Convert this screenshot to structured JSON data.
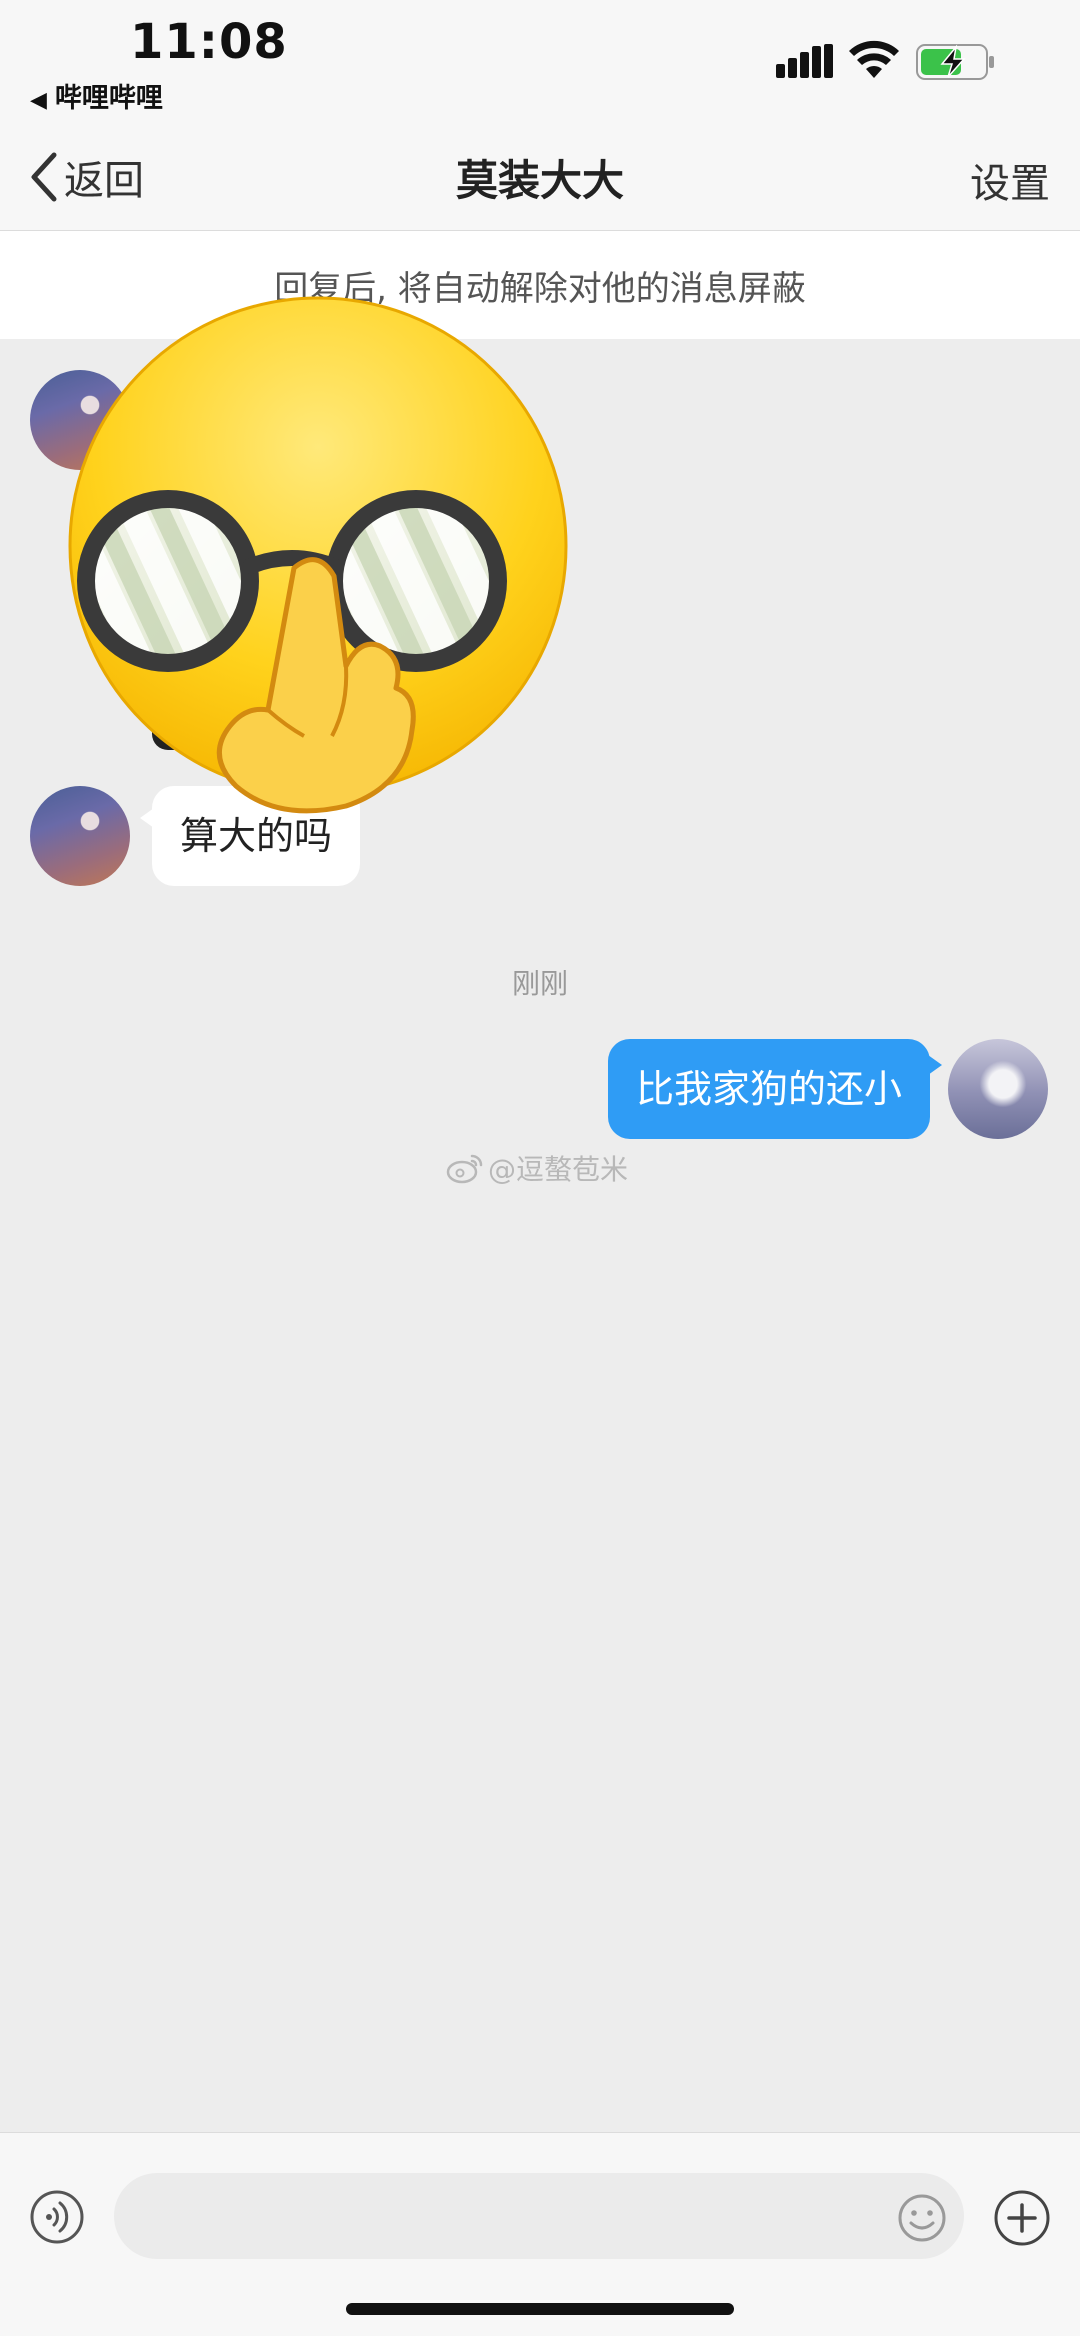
{
  "status_bar": {
    "time": "11:08",
    "back_app": "哔哩哔哩",
    "icons": [
      "signal-icon",
      "wifi-icon",
      "battery-charging-icon"
    ]
  },
  "nav": {
    "back_label": "返回",
    "title": "莫装大大",
    "settings_label": "设置"
  },
  "notice": {
    "text": "回复后, 将自动解除对他的消息屏蔽"
  },
  "messages": [
    {
      "side": "left",
      "type": "sticker",
      "sticker": "glasses-middle-finger-emoji"
    },
    {
      "side": "left",
      "type": "text",
      "text": "算大的吗"
    },
    {
      "side": "divider",
      "text": "刚刚"
    },
    {
      "side": "right",
      "type": "text",
      "text": "比我家狗的还小"
    }
  ],
  "watermark": "@逗螯苞米",
  "input_bar": {
    "icons": [
      "voice-icon",
      "emoji-icon",
      "plus-icon"
    ],
    "placeholder": ""
  },
  "colors": {
    "outgoing_bubble": "#2f9cf5",
    "incoming_bubble": "#ffffff",
    "chat_background": "#ededed"
  }
}
